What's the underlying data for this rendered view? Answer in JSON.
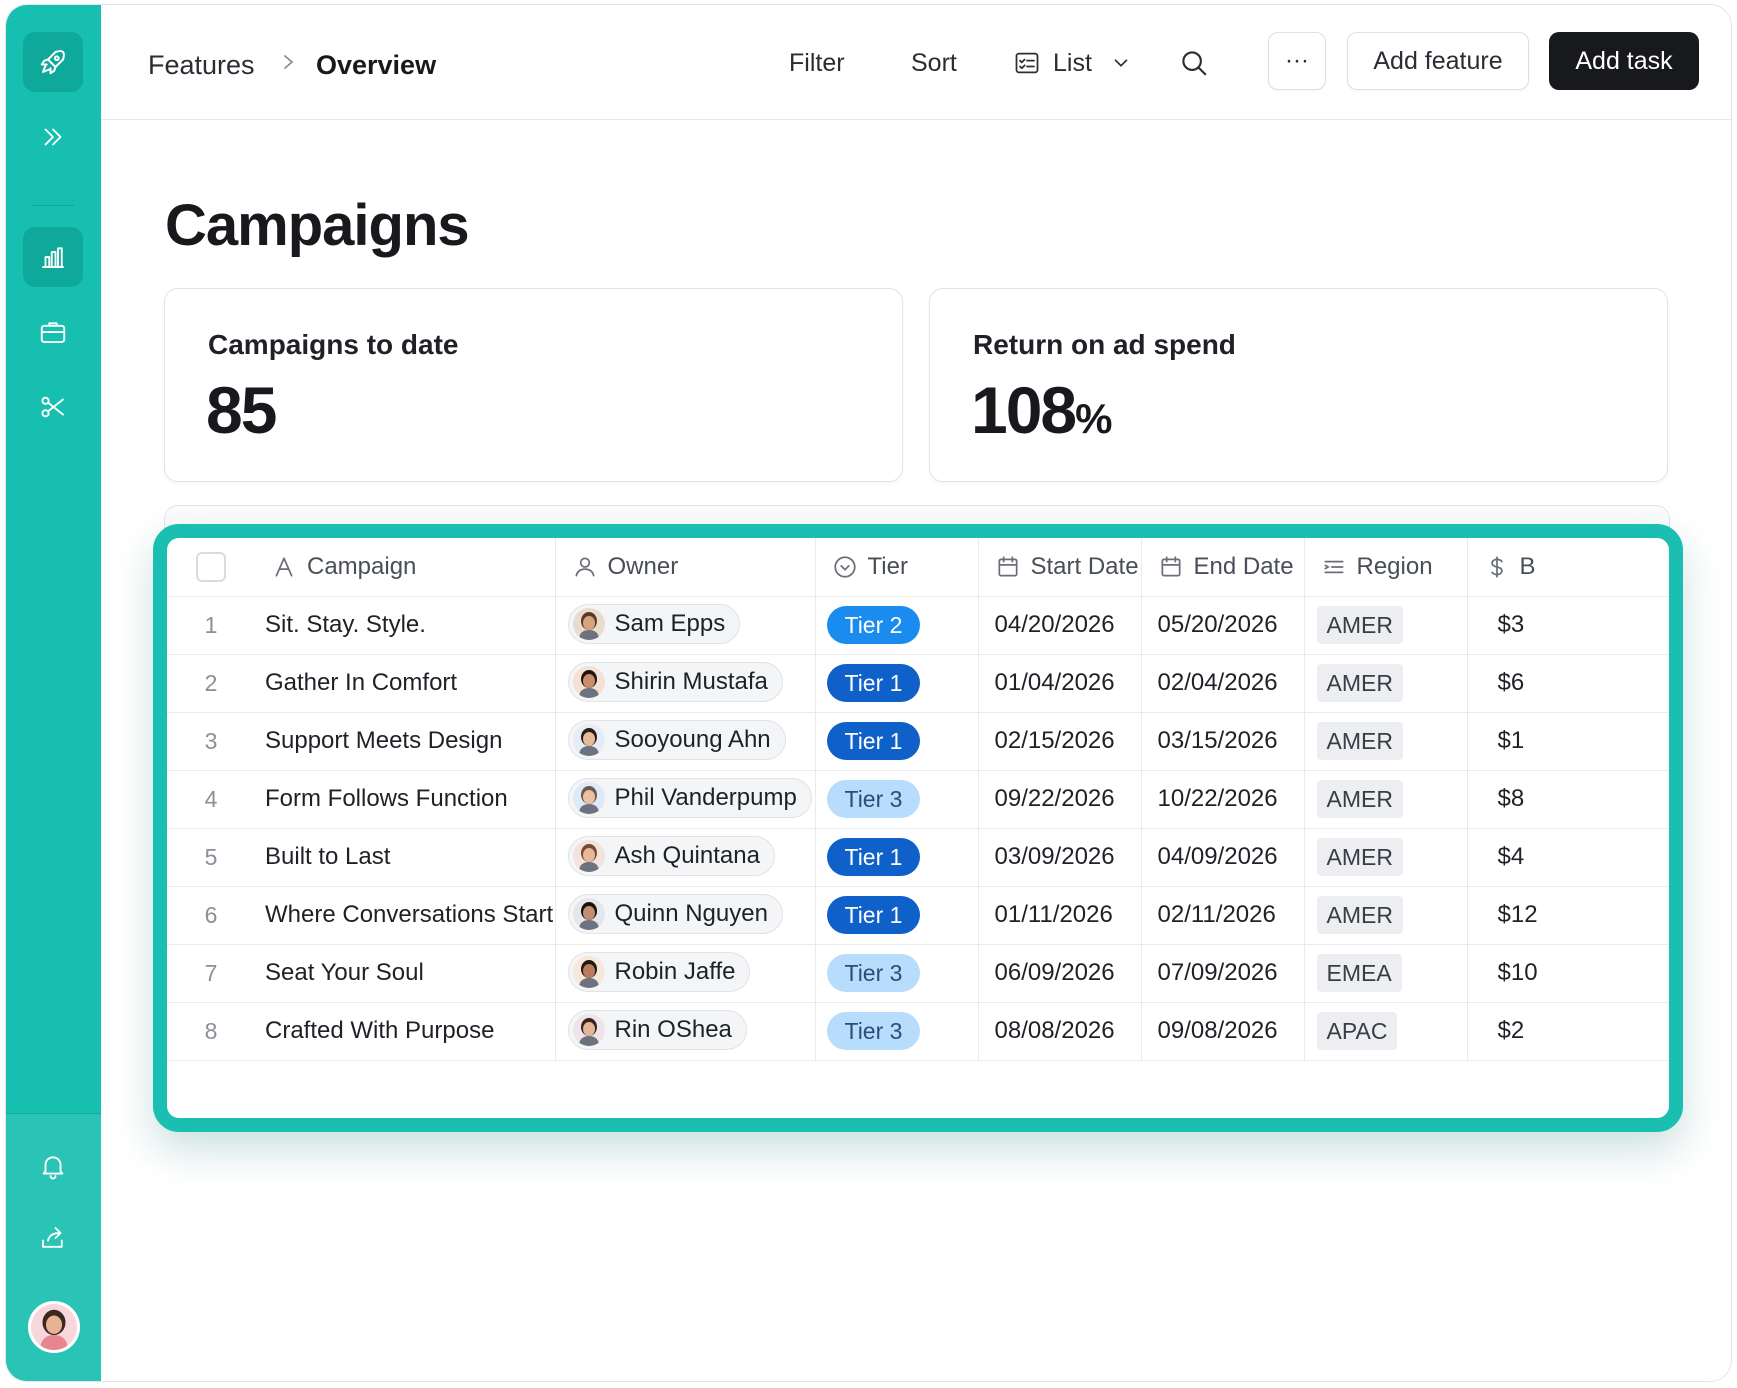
{
  "header": {
    "breadcrumb": [
      "Features",
      "Overview"
    ],
    "filter_label": "Filter",
    "sort_label": "Sort",
    "view_label": "List",
    "more_label": "···",
    "add_feature_label": "Add feature",
    "add_task_label": "Add task"
  },
  "page": {
    "title": "Campaigns"
  },
  "kpis": [
    {
      "label": "Campaigns to date",
      "value": "85",
      "unit": ""
    },
    {
      "label": "Return on ad spend",
      "value": "108",
      "unit": "%"
    }
  ],
  "table": {
    "columns": [
      "Campaign",
      "Owner",
      "Tier",
      "Start Date",
      "End Date",
      "Region",
      "B"
    ],
    "rows": [
      {
        "num": "1",
        "campaign": "Sit. Stay. Style.",
        "owner": "Sam Epps",
        "tier": "Tier 2",
        "start": "04/20/2026",
        "end": "05/20/2026",
        "region": "AMER",
        "budget": "$3"
      },
      {
        "num": "2",
        "campaign": "Gather In Comfort",
        "owner": "Shirin Mustafa",
        "tier": "Tier 1",
        "start": "01/04/2026",
        "end": "02/04/2026",
        "region": "AMER",
        "budget": "$6"
      },
      {
        "num": "3",
        "campaign": "Support Meets Design",
        "owner": "Sooyoung Ahn",
        "tier": "Tier 1",
        "start": "02/15/2026",
        "end": "03/15/2026",
        "region": "AMER",
        "budget": "$1"
      },
      {
        "num": "4",
        "campaign": "Form Follows Function",
        "owner": "Phil Vanderpump",
        "tier": "Tier 3",
        "start": "09/22/2026",
        "end": "10/22/2026",
        "region": "AMER",
        "budget": "$8"
      },
      {
        "num": "5",
        "campaign": "Built to Last",
        "owner": "Ash Quintana",
        "tier": "Tier 1",
        "start": "03/09/2026",
        "end": "04/09/2026",
        "region": "AMER",
        "budget": "$4"
      },
      {
        "num": "6",
        "campaign": "Where Conversations Start",
        "owner": "Quinn Nguyen",
        "tier": "Tier 1",
        "start": "01/11/2026",
        "end": "02/11/2026",
        "region": "AMER",
        "budget": "$12"
      },
      {
        "num": "7",
        "campaign": "Seat Your Soul",
        "owner": "Robin Jaffe",
        "tier": "Tier 3",
        "start": "06/09/2026",
        "end": "07/09/2026",
        "region": "EMEA",
        "budget": "$10"
      },
      {
        "num": "8",
        "campaign": "Crafted With Purpose",
        "owner": "Rin OShea",
        "tier": "Tier 3",
        "start": "08/08/2026",
        "end": "09/08/2026",
        "region": "APAC",
        "budget": "$2"
      }
    ]
  },
  "sidebar": {
    "icons": [
      "rocket-icon",
      "chevrons-right-icon",
      "bar-chart-icon",
      "briefcase-icon",
      "scissors-icon",
      "bell-icon",
      "share-icon"
    ]
  },
  "colors": {
    "brand_teal": "#17bfb0",
    "tier_1": "#0f60c9",
    "tier_2": "#1a8cf0",
    "tier_3": "#b8dcfb"
  }
}
